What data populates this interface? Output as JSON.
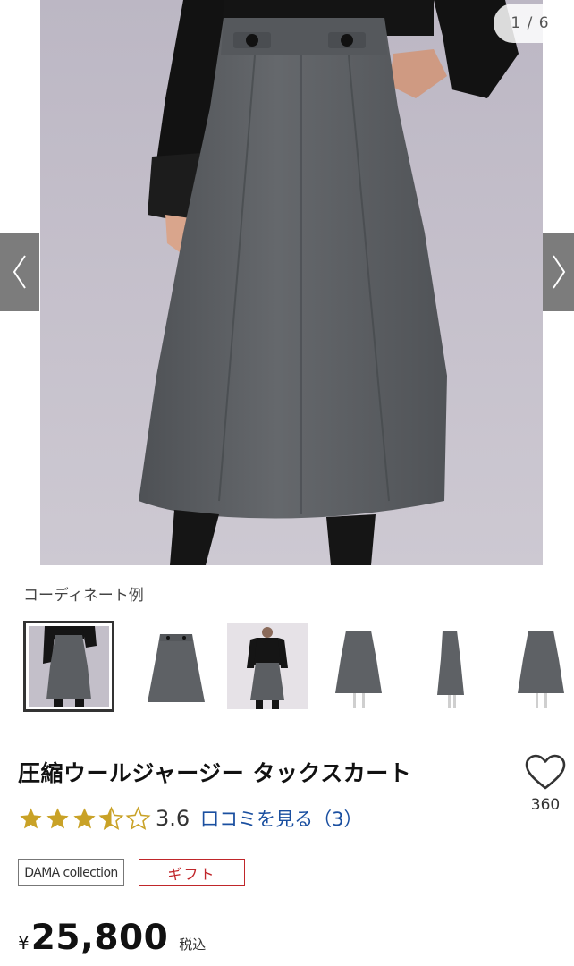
{
  "gallery": {
    "counter": "1 / 6",
    "prev_icon": "chevron-left-icon",
    "next_icon": "chevron-right-icon",
    "caption": "コーディネート例",
    "thumbnail_count": 6,
    "active_thumbnail": 1
  },
  "product": {
    "title": "圧縮ウールジャージー タックスカート",
    "favorite_icon": "heart-icon",
    "favorite_count": "360",
    "rating": {
      "stars_filled": 3.5,
      "stars_total": 5,
      "value": "3.6",
      "review_link": "口コミを見る（3）"
    },
    "brand_badge": "DAMA collection",
    "gift_badge": "ギフト",
    "price": {
      "currency": "¥",
      "amount": "25,800",
      "tax_label": "税込"
    }
  },
  "colors": {
    "star": "#c9a227",
    "link": "#1a4fa0",
    "gift": "#c0262a",
    "skirt": "#5b5e62"
  }
}
